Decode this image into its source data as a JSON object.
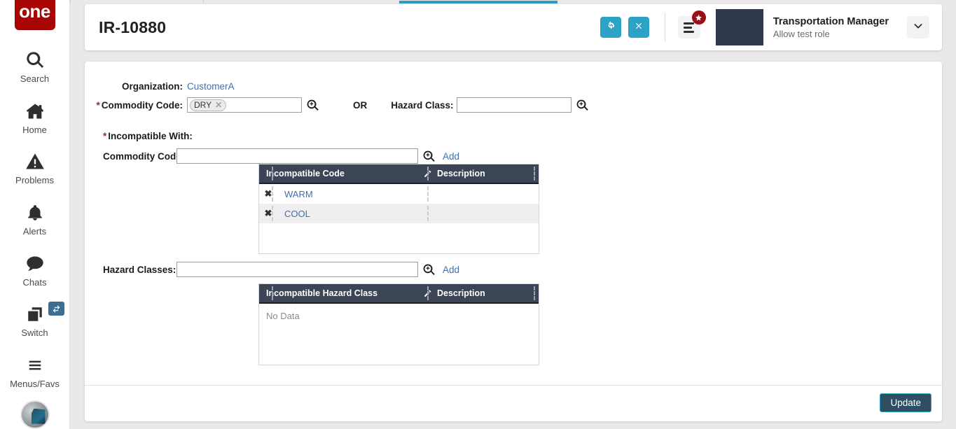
{
  "sidebar": {
    "logo_text": "one",
    "items": [
      {
        "label": "Search",
        "icon": "search-icon"
      },
      {
        "label": "Home",
        "icon": "home-icon"
      },
      {
        "label": "Problems",
        "icon": "warning-triangle-icon"
      },
      {
        "label": "Alerts",
        "icon": "bell-icon"
      },
      {
        "label": "Chats",
        "icon": "chat-bubble-icon"
      },
      {
        "label": "Switch",
        "icon": "windows-stack-icon",
        "badge_icon": "swap-arrows-icon"
      },
      {
        "label": "Menus/Favs",
        "icon": "hamburger-icon"
      }
    ],
    "avatar": "user-avatar"
  },
  "header": {
    "title": "IR-10880",
    "refresh_icon": "refresh-icon",
    "close_icon": "close-icon",
    "menu_icon": "menu-lines-icon",
    "star_badge_icon": "star-icon",
    "user_name": "Transportation Manager",
    "user_role": "Allow test role",
    "chevron_icon": "chevron-down-icon"
  },
  "form": {
    "organization_label": "Organization:",
    "organization_value": "CustomerA",
    "commodity_code_label": "Commodity Code:",
    "commodity_code_chip": "DRY",
    "commodity_code_chip_remove": "✕",
    "or_text": "OR",
    "hazard_class_label": "Hazard Class:",
    "hazard_class_value": "",
    "hazard_class_placeholder": "",
    "incompatible_with_label": "Incompatible With:",
    "commodity_codes_label": "Commodity Codes:",
    "commodity_codes_value": "",
    "commodity_codes_placeholder": "",
    "hazard_classes_label": "Hazard Classes:",
    "hazard_classes_value": "",
    "hazard_classes_placeholder": "",
    "add_label": "Add",
    "required_marker": "*",
    "search_icon": "magnifier-plus-icon"
  },
  "commodity_grid": {
    "columns": [
      "Incompatible Code",
      "Description"
    ],
    "edit_icon": "edit-pencil-icon",
    "rows": [
      {
        "code": "WARM",
        "description": ""
      },
      {
        "code": "COOL",
        "description": ""
      }
    ],
    "remove_icon": "✖"
  },
  "hazard_grid": {
    "columns": [
      "Incompatible Hazard Class",
      "Description"
    ],
    "edit_icon": "edit-pencil-icon",
    "rows": [],
    "empty_text": "No Data"
  },
  "footer": {
    "update_label": "Update"
  },
  "colors": {
    "brand_red": "#a90505",
    "accent_teal": "#2ca2c6",
    "grid_header": "#3b4555",
    "link_blue": "#3f6fb0",
    "update_bg": "#2e4f63",
    "badge_red": "#9b0d17"
  }
}
